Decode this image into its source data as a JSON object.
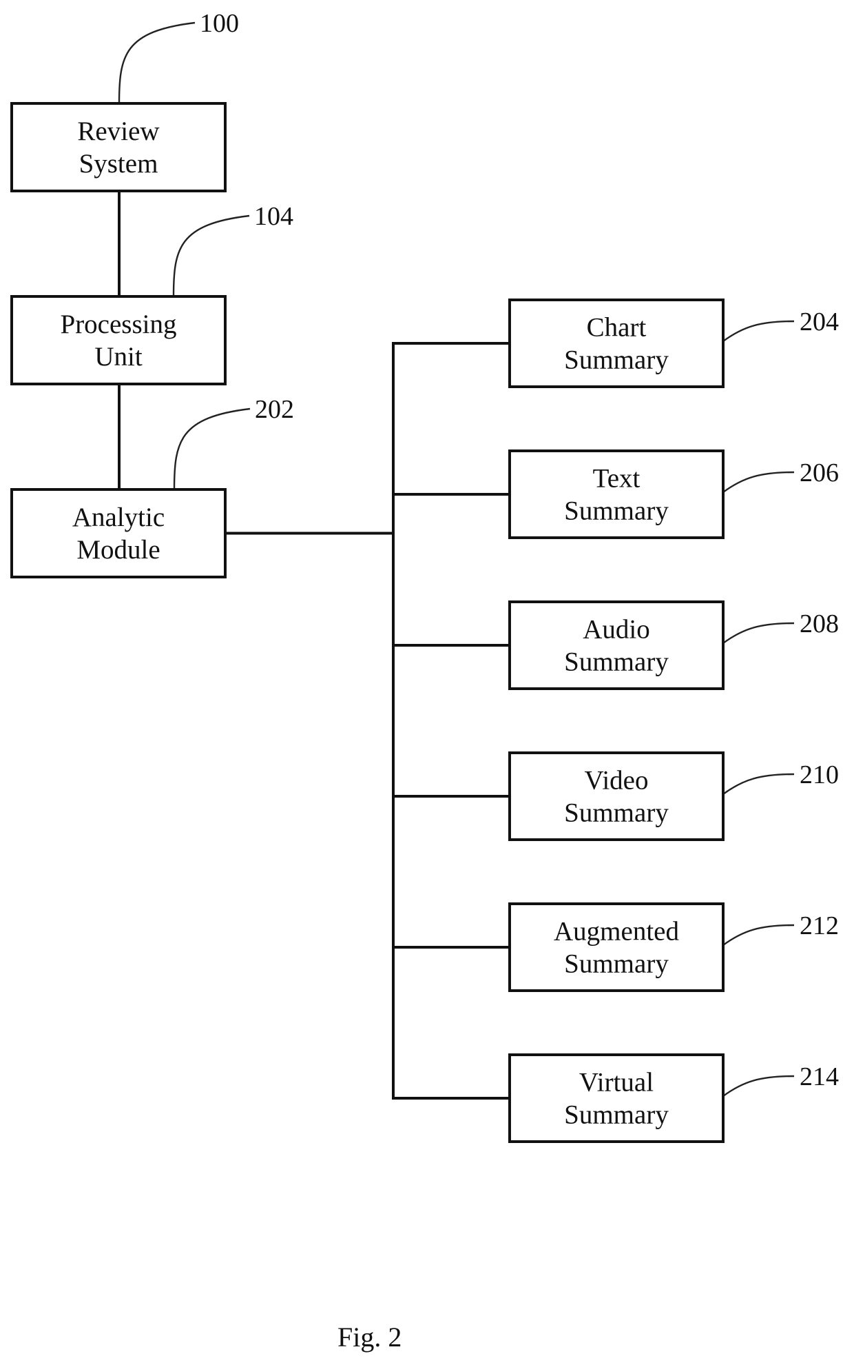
{
  "figure": {
    "caption": "Fig. 2",
    "line_color": "#111111",
    "background": "#ffffff"
  },
  "left_column": [
    {
      "id": "review-system",
      "lines": [
        "Review",
        "System"
      ],
      "ref": "100"
    },
    {
      "id": "processing-unit",
      "lines": [
        "Processing",
        "Unit"
      ],
      "ref": "104"
    },
    {
      "id": "analytic-module",
      "lines": [
        "Analytic",
        "Module"
      ],
      "ref": "202"
    }
  ],
  "summaries": [
    {
      "id": "chart-summary",
      "lines": [
        "Chart",
        "Summary"
      ],
      "ref": "204"
    },
    {
      "id": "text-summary",
      "lines": [
        "Text",
        "Summary"
      ],
      "ref": "206"
    },
    {
      "id": "audio-summary",
      "lines": [
        "Audio",
        "Summary"
      ],
      "ref": "208"
    },
    {
      "id": "video-summary",
      "lines": [
        "Video",
        "Summary"
      ],
      "ref": "210"
    },
    {
      "id": "augmented-summary",
      "lines": [
        "Augmented",
        "Summary"
      ],
      "ref": "212"
    },
    {
      "id": "virtual-summary",
      "lines": [
        "Virtual",
        "Summary"
      ],
      "ref": "214"
    }
  ],
  "connections": [
    {
      "from": "review-system",
      "to": "processing-unit"
    },
    {
      "from": "processing-unit",
      "to": "analytic-module"
    },
    {
      "from": "analytic-module",
      "to": "chart-summary"
    },
    {
      "from": "analytic-module",
      "to": "text-summary"
    },
    {
      "from": "analytic-module",
      "to": "audio-summary"
    },
    {
      "from": "analytic-module",
      "to": "video-summary"
    },
    {
      "from": "analytic-module",
      "to": "augmented-summary"
    },
    {
      "from": "analytic-module",
      "to": "virtual-summary"
    }
  ]
}
